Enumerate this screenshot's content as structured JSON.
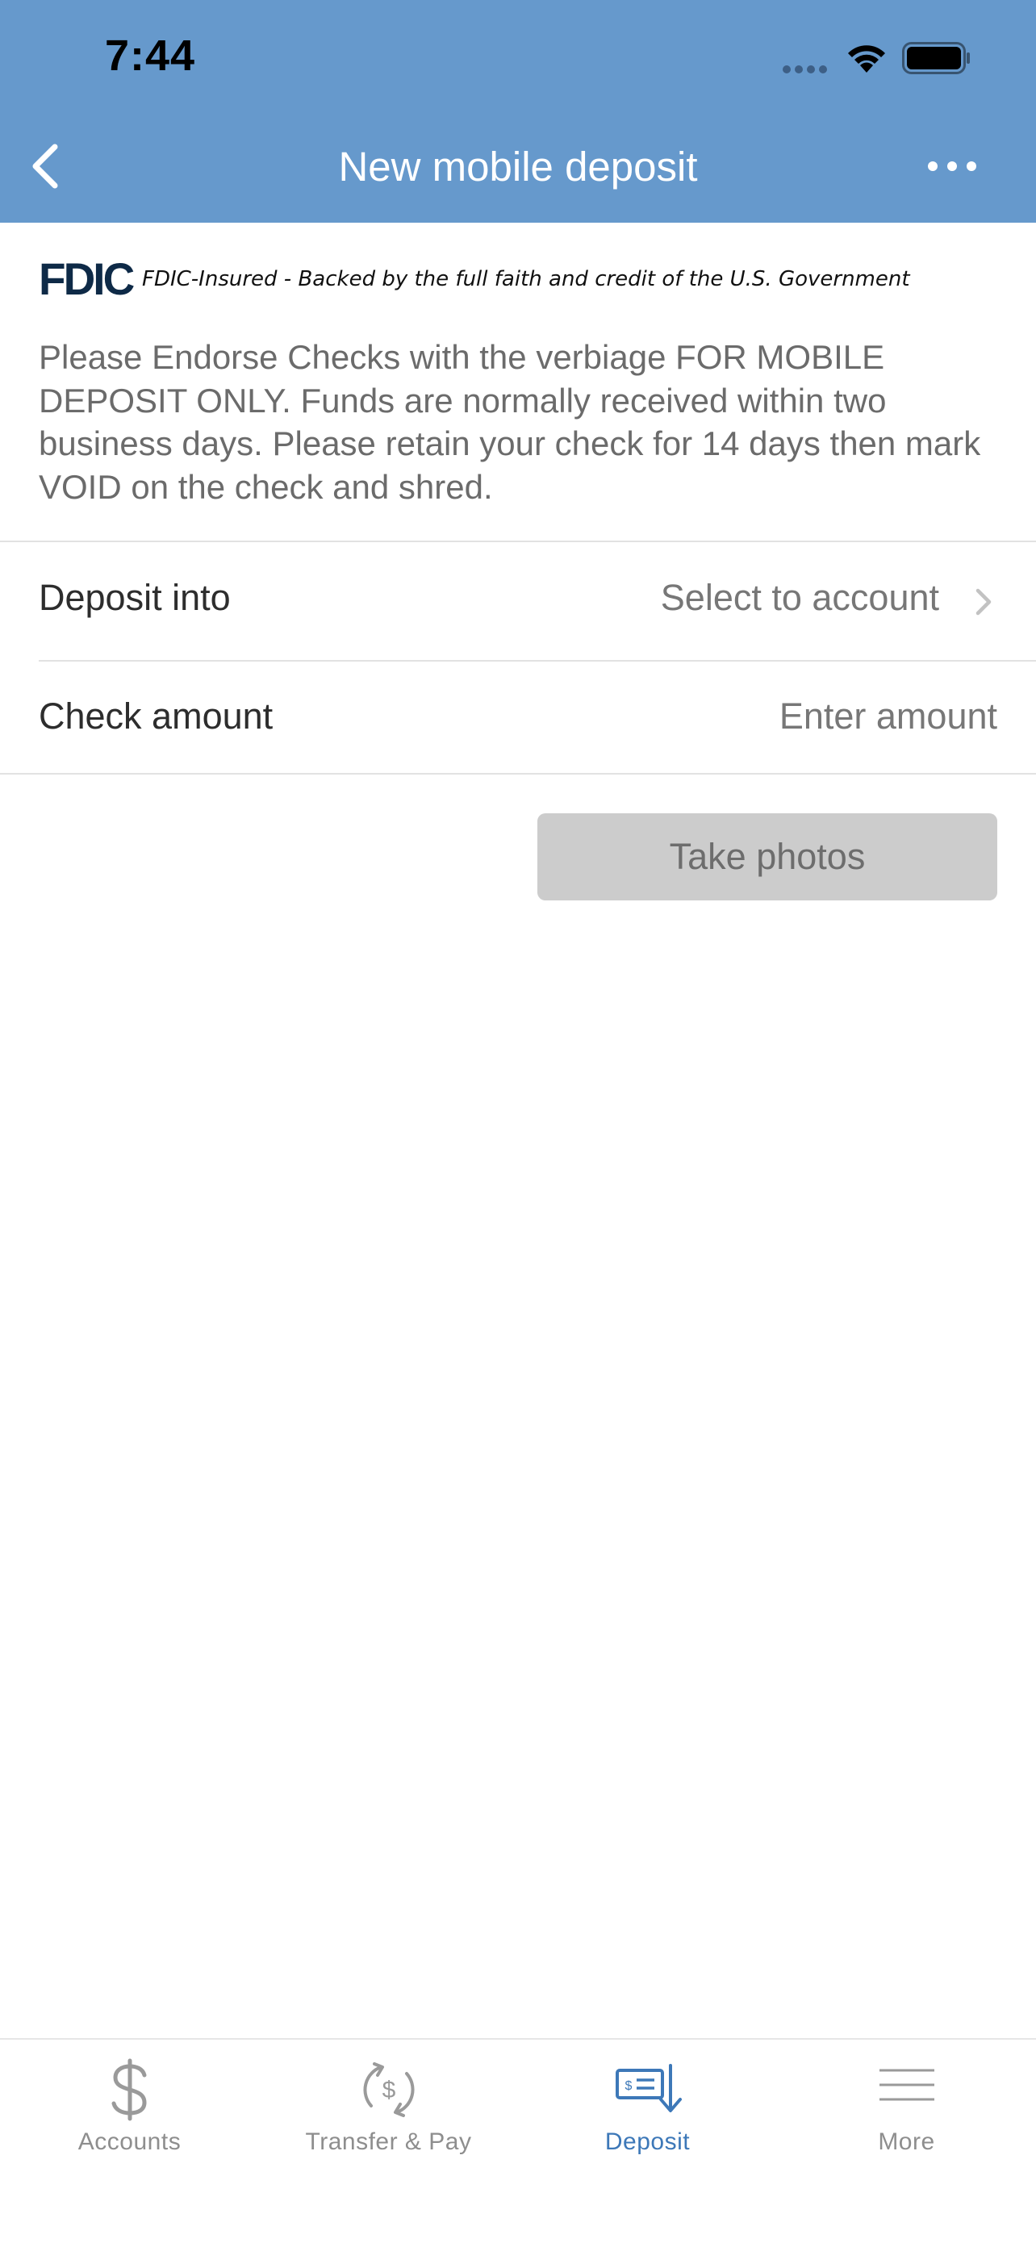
{
  "status_bar": {
    "time": "7:44"
  },
  "header": {
    "title": "New mobile deposit",
    "back_icon": "chevron-left-icon",
    "more_icon": "ellipsis-icon",
    "background_color": "#6699cc"
  },
  "fdic": {
    "logo_text": "FDIC",
    "tagline": "FDIC-Insured - Backed by the full faith and credit of the U.S. Government"
  },
  "notice": "Please Endorse Checks with the verbiage FOR MOBILE DEPOSIT ONLY. Funds are normally received within two business days. Please retain your check for 14 days then mark VOID on the check and shred.",
  "form": {
    "deposit_into": {
      "label": "Deposit into",
      "value": "Select to account"
    },
    "check_amount": {
      "label": "Check amount",
      "placeholder": "Enter amount"
    }
  },
  "take_photos_label": "Take photos",
  "tabbar": {
    "active_color": "#3d78b8",
    "inactive_color": "#8e8e8e",
    "items": [
      {
        "label": "Accounts",
        "icon": "dollar-icon"
      },
      {
        "label": "Transfer & Pay",
        "icon": "transfer-dollar-icon"
      },
      {
        "label": "Deposit",
        "icon": "check-deposit-icon",
        "active": true
      },
      {
        "label": "More",
        "icon": "menu-icon"
      }
    ]
  }
}
